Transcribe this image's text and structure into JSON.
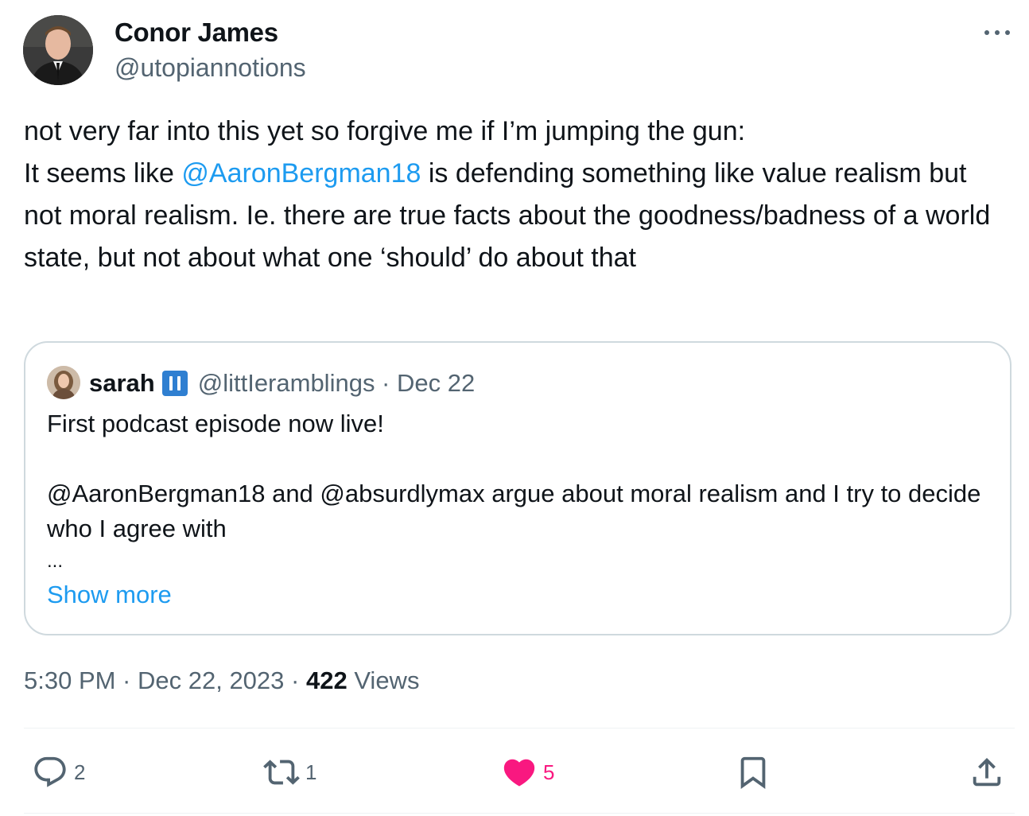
{
  "author": {
    "name": "Conor James",
    "handle": "@utopiannotions"
  },
  "tweet": {
    "line1": "not very far into this yet so forgive me if I’m jumping the gun:",
    "line2_prefix": "It seems like ",
    "line2_mention": "@AaronBergman18",
    "line2_suffix": " is defending something like value realism but not moral realism. Ie. there are true facts about the goodness/badness of a world state, but not about what one ‘should’ do about that"
  },
  "quote": {
    "name": "sarah",
    "badge_icon": "pause-flag-icon",
    "handle_date": "@littIeramblings · Dec 22",
    "line1": "First podcast episode now live!",
    "line2": "@AaronBergman18 and @absurdlymax argue about moral realism and I try to decide who I agree with",
    "ellipsis": "...",
    "show_more": "Show more"
  },
  "meta": {
    "timestamp": "5:30 PM · Dec 22, 2023 · ",
    "views_count": "422",
    "views_label": " Views"
  },
  "actions": {
    "replies": "2",
    "retweets": "1",
    "likes": "5"
  },
  "colors": {
    "accent": "#1d9bf0",
    "like": "#f91880",
    "muted": "#536471",
    "border": "#cfd9de"
  }
}
